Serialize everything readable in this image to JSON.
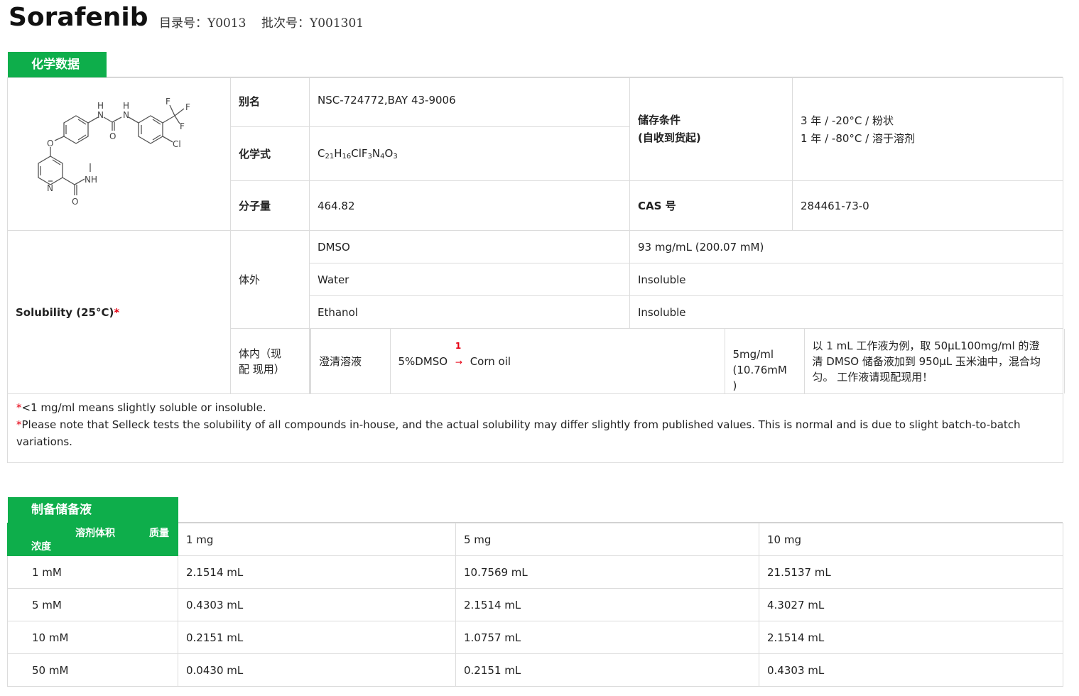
{
  "header": {
    "product_name": "Sorafenib",
    "catalog_label": "目录号：Y0013",
    "batch_label": "批次号：Y001301"
  },
  "chem": {
    "section_title": "化学数据",
    "alias_label": "别名",
    "alias_value": "NSC-724772,BAY 43-9006",
    "formula_label": "化学式",
    "formula_parts": [
      "C",
      "21",
      "H",
      "16",
      "ClF",
      "3",
      "N",
      "4",
      "O",
      "3"
    ],
    "mw_label": "分子量",
    "mw_value": "464.82",
    "storage_label_1": "储存条件",
    "storage_label_2": "(自收到货起)",
    "storage_value_1": "3 年 / -20°C / 粉状",
    "storage_value_2": "1 年 / -80°C / 溶于溶剂",
    "cas_label": "CAS 号",
    "cas_value": "284461-73-0",
    "structure_atoms": {
      "h1": "H",
      "n1": "N",
      "h2": "H",
      "n2": "N",
      "o1": "O",
      "f1": "F",
      "f2": "F",
      "f3": "F",
      "cl": "Cl",
      "o2": "O",
      "n3": "N",
      "nh": "NH",
      "o3": "O"
    }
  },
  "solubility": {
    "label": "Solubility (25°C)",
    "asterisk": "*",
    "in_vitro_label": "体外",
    "rows": [
      {
        "solvent": "DMSO",
        "value": "93 mg/mL (200.07 mM)"
      },
      {
        "solvent": "Water",
        "value": "Insoluble"
      },
      {
        "solvent": "Ethanol",
        "value": "Insoluble"
      }
    ],
    "in_vivo_label_1": "体内（现",
    "in_vivo_label_2": "配 现用）",
    "in_vivo_type": "澄清溶液",
    "in_vivo_formula_a": "5%DMSO",
    "in_vivo_step": "1",
    "in_vivo_arrow": "→",
    "in_vivo_formula_b": "Corn oil",
    "in_vivo_conc_1": "5mg/ml",
    "in_vivo_conc_2": "(10.76mM",
    "in_vivo_conc_3": ")",
    "in_vivo_desc_1": "以 1 mL 工作液为例，取 50μL100mg/ml 的澄",
    "in_vivo_desc_2": "清 DMSO 储备液加到 950μL 玉米油中，混合均",
    "in_vivo_desc_3": "匀。 工作液请现配现用！"
  },
  "notes": {
    "star": "*",
    "note1": "<1 mg/ml means slightly soluble or insoluble.",
    "note2": "Please note that Selleck tests the solubility of all compounds in-house, and the actual solubility may differ slightly from published values. This is normal and is due to slight batch-to-batch",
    "note2b": "variations."
  },
  "stock": {
    "section_title": "制备储备液",
    "head_volume": "溶剂体积",
    "head_mass": "质量",
    "head_conc": "浓度",
    "masses": [
      "1 mg",
      "5 mg",
      "10 mg"
    ],
    "rows": [
      {
        "conc": "1 mM",
        "values": [
          "2.1514 mL",
          "10.7569 mL",
          "21.5137 mL"
        ]
      },
      {
        "conc": "5 mM",
        "values": [
          "0.4303 mL",
          "2.1514 mL",
          "4.3027 mL"
        ]
      },
      {
        "conc": "10 mM",
        "values": [
          "0.2151 mL",
          "1.0757 mL",
          "2.1514 mL"
        ]
      },
      {
        "conc": "50 mM",
        "values": [
          "0.0430 mL",
          "0.2151 mL",
          "0.4303 mL"
        ]
      }
    ]
  }
}
